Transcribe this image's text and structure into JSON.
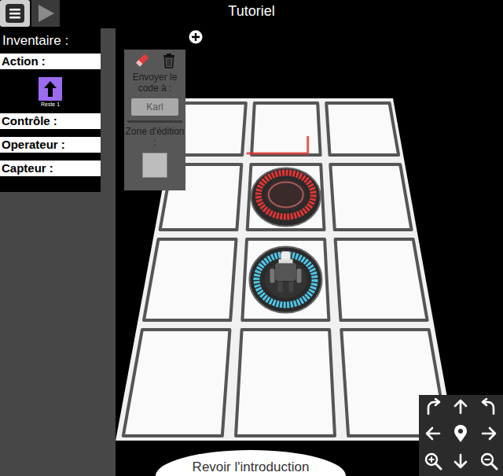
{
  "title": "Tutoriel",
  "inventory": {
    "title": "Inventaire :",
    "sections": [
      {
        "label": "Action :",
        "blocks": [
          {
            "remaining": "Reste 1"
          }
        ]
      },
      {
        "label": "Contrôle :",
        "blocks": []
      },
      {
        "label": "Operateur :",
        "blocks": []
      },
      {
        "label": "Capteur :",
        "blocks": []
      }
    ]
  },
  "script_panel": {
    "send_label": "Envoyer le code à :",
    "agent": "Karl",
    "edit_label": "Zone d'édition :"
  },
  "board": {
    "rows": [
      [
        "floor",
        "floor",
        "floor"
      ],
      [
        "floor",
        "exit",
        "floor"
      ],
      [
        "floor",
        "robot",
        "floor"
      ],
      [
        "floor",
        "floor",
        "floor"
      ]
    ]
  },
  "intro_button": "Revoir l'introduction"
}
